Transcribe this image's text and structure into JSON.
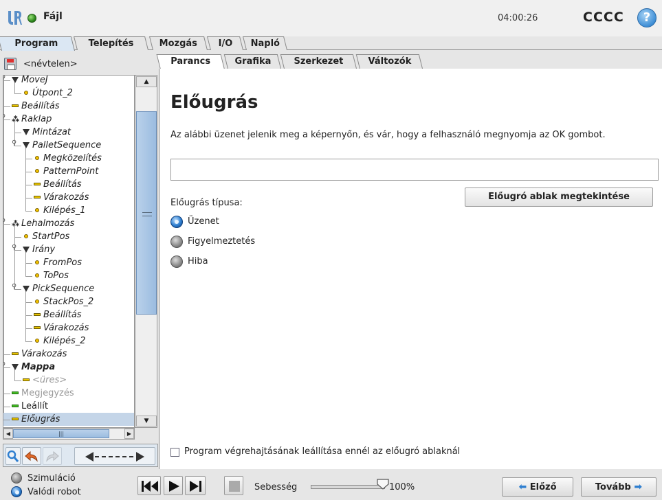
{
  "header": {
    "file_menu": "Fájl",
    "clock": "04:00:26",
    "robot_name": "CCCC",
    "help_glyph": "?"
  },
  "main_tabs": [
    {
      "label": "Program",
      "active": true
    },
    {
      "label": "Telepítés",
      "active": false
    },
    {
      "label": "Mozgás",
      "active": false
    },
    {
      "label": "I/O",
      "active": false
    },
    {
      "label": "Napló",
      "active": false
    }
  ],
  "program": {
    "name": "<névtelen>"
  },
  "tree": [
    {
      "label": "MoveJ",
      "icon": "triangle",
      "depth": 0,
      "row": 0
    },
    {
      "label": "Útpont_2",
      "icon": "dot",
      "depth": 1,
      "row": 1
    },
    {
      "label": "Beállítás",
      "icon": "bar",
      "depth": 0,
      "row": 2
    },
    {
      "label": "Raklap",
      "icon": "pallet",
      "depth": 0,
      "row": 3
    },
    {
      "label": "Mintázat",
      "icon": "triangle",
      "depth": 1,
      "row": 4
    },
    {
      "label": "PalletSequence",
      "icon": "triangle",
      "depth": 1,
      "row": 5
    },
    {
      "label": "Megközelítés",
      "icon": "dot",
      "depth": 2,
      "row": 6
    },
    {
      "label": "PatternPoint",
      "icon": "dot",
      "depth": 2,
      "row": 7
    },
    {
      "label": "Beállítás",
      "icon": "bar",
      "depth": 2,
      "row": 8
    },
    {
      "label": "Várakozás",
      "icon": "bar",
      "depth": 2,
      "row": 9
    },
    {
      "label": "Kilépés_1",
      "icon": "dot",
      "depth": 2,
      "row": 10
    },
    {
      "label": "Lehalmozás",
      "icon": "pallet",
      "depth": 0,
      "row": 11
    },
    {
      "label": "StartPos",
      "icon": "dot",
      "depth": 1,
      "row": 12
    },
    {
      "label": "Irány",
      "icon": "triangle",
      "depth": 1,
      "row": 13
    },
    {
      "label": "FromPos",
      "icon": "dot",
      "depth": 2,
      "row": 14
    },
    {
      "label": "ToPos",
      "icon": "dot",
      "depth": 2,
      "row": 15
    },
    {
      "label": "PickSequence",
      "icon": "triangle",
      "depth": 1,
      "row": 16
    },
    {
      "label": "StackPos_2",
      "icon": "dot",
      "depth": 2,
      "row": 17
    },
    {
      "label": "Beállítás",
      "icon": "bar",
      "depth": 2,
      "row": 18
    },
    {
      "label": "Várakozás",
      "icon": "bar",
      "depth": 2,
      "row": 19
    },
    {
      "label": "Kilépés_2",
      "icon": "dot",
      "depth": 2,
      "row": 20
    },
    {
      "label": "Várakozás",
      "icon": "bar",
      "depth": 0,
      "row": 21
    },
    {
      "label": "Mappa",
      "icon": "triangle",
      "depth": 0,
      "row": 22,
      "style": "bold"
    },
    {
      "label": "<üres>",
      "icon": "bar",
      "depth": 1,
      "row": 23,
      "style": "grey"
    },
    {
      "label": "Megjegyzés",
      "icon": "greenbar",
      "depth": 0,
      "row": 24,
      "style": "grey-normal"
    },
    {
      "label": "Leállít",
      "icon": "greenbar",
      "depth": 0,
      "row": 25,
      "style": "normal"
    },
    {
      "label": "Előugrás",
      "icon": "bar",
      "depth": 0,
      "row": 26,
      "style": "selected"
    }
  ],
  "sub_tabs": [
    {
      "label": "Parancs",
      "active": true
    },
    {
      "label": "Grafika",
      "active": false
    },
    {
      "label": "Szerkezet",
      "active": false
    },
    {
      "label": "Változók",
      "active": false
    }
  ],
  "popup": {
    "heading": "Előugrás",
    "description": "Az alábbi üzenet jelenik meg a képernyőn, és vár, hogy a felhasználó megnyomja az OK gombot.",
    "message_value": "",
    "preview_button": "Előugró ablak megtekintése",
    "type_label": "Előugrás típusa:",
    "types": [
      {
        "label": "Üzenet",
        "selected": true
      },
      {
        "label": "Figyelmeztetés",
        "selected": false
      },
      {
        "label": "Hiba",
        "selected": false
      }
    ],
    "stop_checkbox_label": "Program végrehajtásának leállítása ennél az előugró ablaknál",
    "stop_checked": false
  },
  "footer": {
    "modes": [
      {
        "label": "Szimuláció",
        "selected": false
      },
      {
        "label": "Valódi robot",
        "selected": true
      }
    ],
    "speed_label": "Sebesség",
    "speed_value": "100%",
    "speed_fraction": 1.0,
    "prev_button": "Előző",
    "next_button": "Tovább"
  },
  "colors": {
    "accent_blue": "#2f7fd0",
    "status_green": "#2f8a1e",
    "selection": "#c4d5e8"
  }
}
